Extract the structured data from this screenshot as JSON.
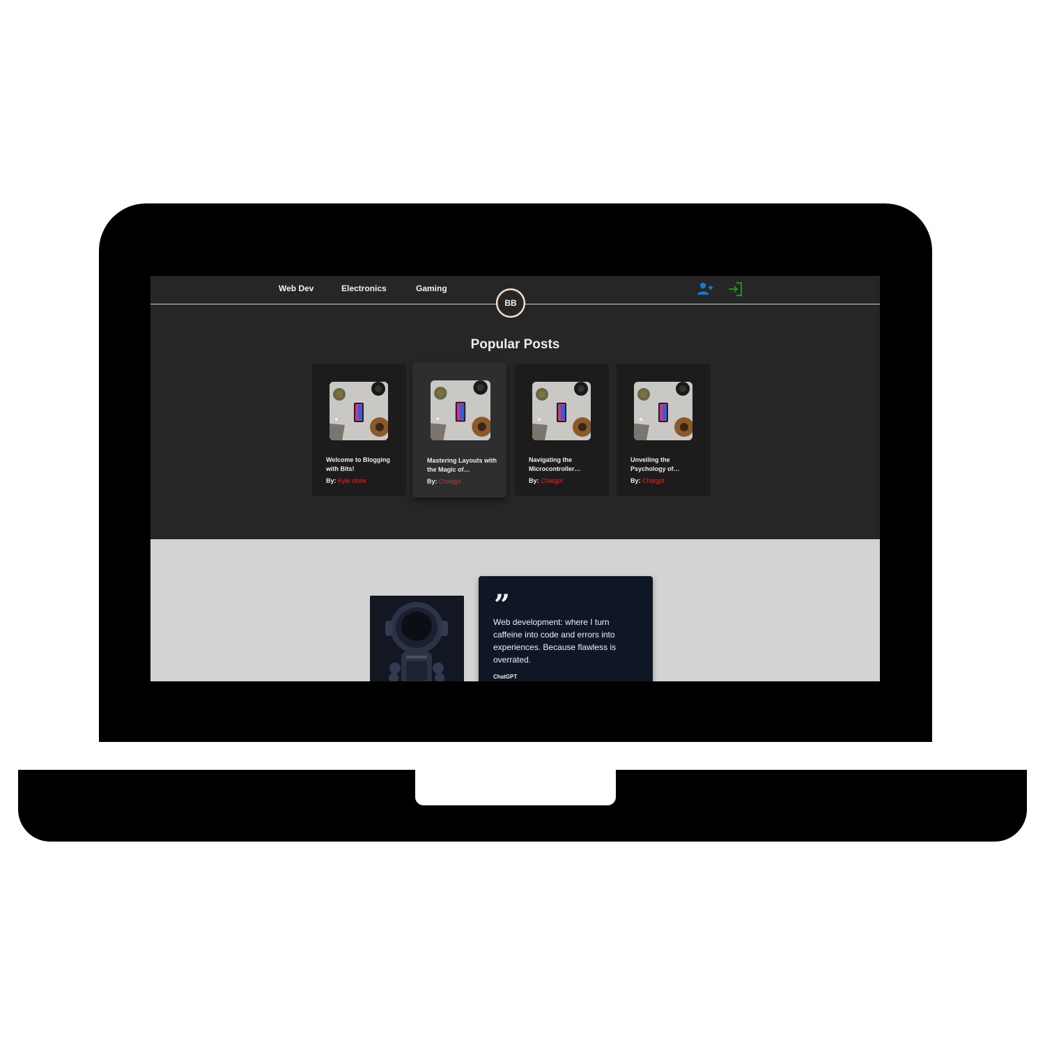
{
  "nav": {
    "links": [
      "Web Dev",
      "Electronics",
      "Gaming"
    ],
    "logo_text": "BB",
    "register_icon": "user-plus-icon",
    "login_icon": "sign-in-icon",
    "colors": {
      "register": "#1c78d6",
      "login": "#1f9d2a"
    }
  },
  "popular": {
    "title": "Popular Posts",
    "by_label": "By:",
    "posts": [
      {
        "title": "Welcome to Blogging with Bits!",
        "author": "Kyle close"
      },
      {
        "title": "Mastering Layouts with the Magic of…",
        "author": "Chatgpt"
      },
      {
        "title": "Navigating the Microcontroller…",
        "author": "Chatgpt"
      },
      {
        "title": "Unveiling the Psychology of…",
        "author": "Chatgpt"
      }
    ],
    "accent_color": "#e02a2a"
  },
  "testimonial": {
    "quote": "Web development: where I turn caffeine into code and errors into experiences. Because flawless is overrated.",
    "author": "ChatGPT"
  }
}
